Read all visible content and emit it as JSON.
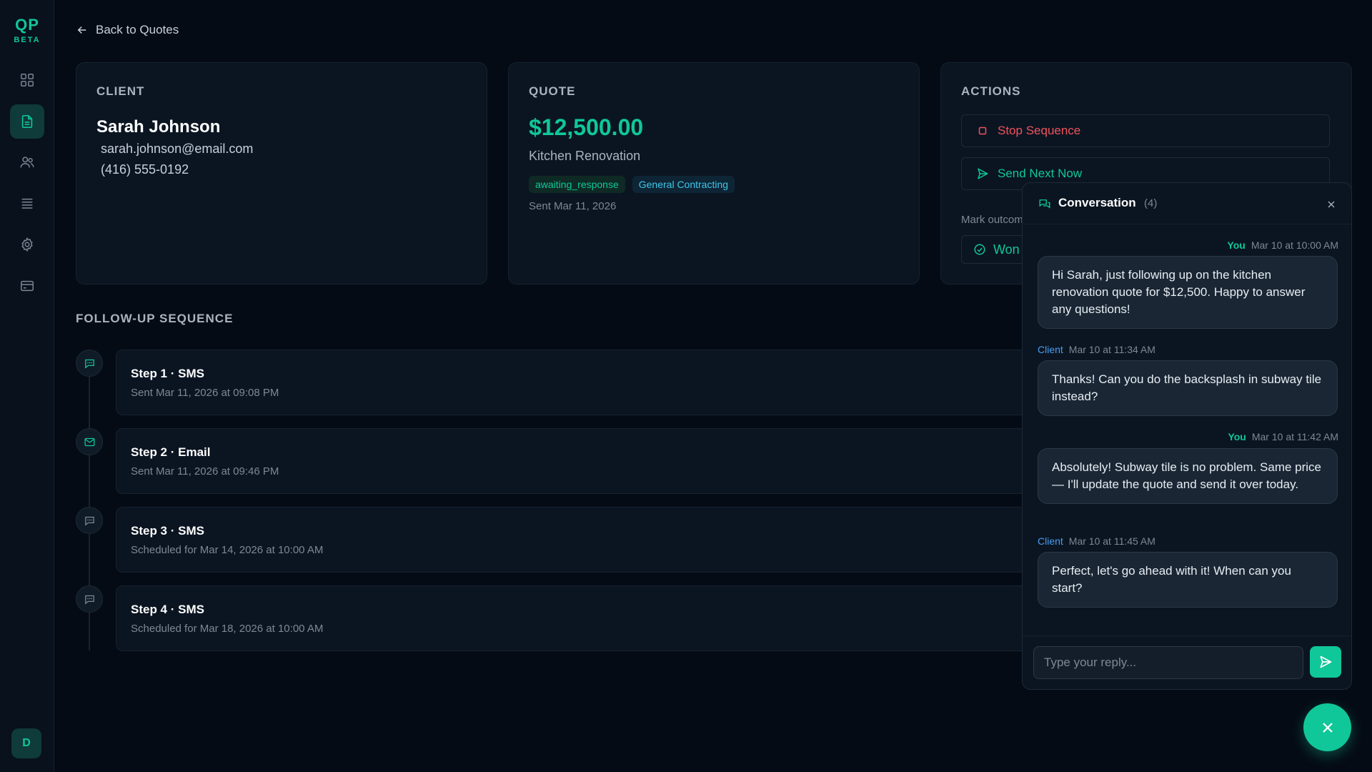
{
  "brand": {
    "logo": "QP",
    "badge": "BETA"
  },
  "sidebar": {
    "items": [
      {
        "icon": "grid-icon"
      },
      {
        "icon": "document-icon",
        "active": true
      },
      {
        "icon": "users-icon"
      },
      {
        "icon": "list-icon"
      },
      {
        "icon": "gear-icon"
      },
      {
        "icon": "credit-card-icon"
      }
    ],
    "avatar": "D"
  },
  "nav": {
    "back_label": "Back to Quotes"
  },
  "client": {
    "heading": "CLIENT",
    "name": "Sarah Johnson",
    "email": "sarah.johnson@email.com",
    "phone": "(416) 555-0192"
  },
  "quote": {
    "heading": "QUOTE",
    "amount": "$12,500.00",
    "title": "Kitchen Renovation",
    "status_tag": "awaiting_response",
    "category_tag": "General Contracting",
    "sent": "Sent Mar 11, 2026"
  },
  "actions": {
    "heading": "ACTIONS",
    "stop_label": "Stop Sequence",
    "send_next_label": "Send Next Now",
    "mark_outcome_label": "Mark outcom",
    "won_label": "Won"
  },
  "sequence": {
    "heading": "FOLLOW-UP SEQUENCE",
    "steps": [
      {
        "title": "Step 1 · SMS",
        "sub": "Sent Mar 11, 2026 at 09:08 PM",
        "icon": "chat-icon"
      },
      {
        "title": "Step 2 · Email",
        "sub": "Sent Mar 11, 2026 at 09:46 PM",
        "icon": "mail-icon"
      },
      {
        "title": "Step 3 · SMS",
        "sub": "Scheduled for Mar 14, 2026 at 10:00 AM",
        "icon": "chat-icon"
      },
      {
        "title": "Step 4 · SMS",
        "sub": "Scheduled for Mar 18, 2026 at 10:00 AM",
        "icon": "chat-icon"
      }
    ]
  },
  "conversation": {
    "title": "Conversation",
    "count": "(4)",
    "messages": [
      {
        "from": "You",
        "time": "Mar 10 at 10:00 AM",
        "text": "Hi Sarah, just following up on the kitchen renovation quote for $12,500. Happy to answer any questions!"
      },
      {
        "from": "Client",
        "time": "Mar 10 at 11:34 AM",
        "text": "Thanks! Can you do the backsplash in subway tile instead?"
      },
      {
        "from": "You",
        "time": "Mar 10 at 11:42 AM",
        "text": "Absolutely! Subway tile is no problem. Same price — I'll update the quote and send it over today."
      },
      {
        "from": "Client",
        "time": "Mar 10 at 11:45 AM",
        "text": "Perfect, let's go ahead with it! When can you start?"
      }
    ],
    "reply_placeholder": "Type your reply..."
  },
  "colors": {
    "accent": "#10c79a",
    "danger": "#f0525b",
    "client_label": "#4a9df0",
    "background": "#050b14"
  }
}
